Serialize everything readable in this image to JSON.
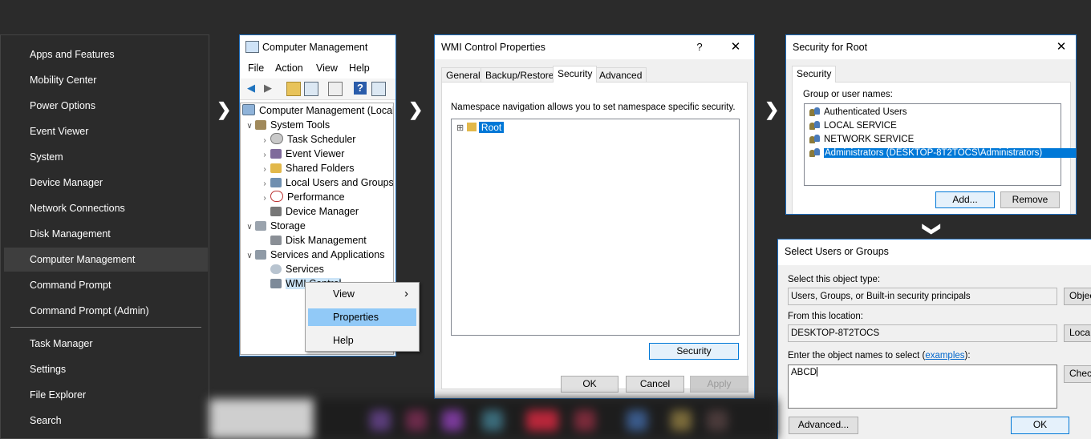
{
  "winx_menu": {
    "items": [
      "Apps and Features",
      "Mobility Center",
      "Power Options",
      "Event Viewer",
      "System",
      "Device Manager",
      "Network Connections",
      "Disk Management",
      "Computer Management",
      "Command Prompt",
      "Command Prompt (Admin)",
      "Task Manager",
      "Settings",
      "File Explorer",
      "Search"
    ],
    "selected": "Computer Management"
  },
  "arrows": {
    "right": "❯",
    "down": "❯"
  },
  "computer_management": {
    "title": "Computer Management",
    "menu": [
      "File",
      "Action",
      "View",
      "Help"
    ],
    "tree": [
      "Computer Management (Local",
      "System Tools",
      "Task Scheduler",
      "Event Viewer",
      "Shared Folders",
      "Local Users and Groups",
      "Performance",
      "Device Manager",
      "Storage",
      "Disk Management",
      "Services and Applications",
      "Services",
      "WMI Control"
    ],
    "context_menu": {
      "items": [
        "View",
        "Properties",
        "Help"
      ],
      "selected": "Properties",
      "submenu_arrow": "›"
    }
  },
  "wmi_dialog": {
    "title": "WMI Control Properties",
    "help_glyph": "?",
    "close_glyph": "✕",
    "tabs": [
      "General",
      "Backup/Restore",
      "Security",
      "Advanced"
    ],
    "active_tab": "Security",
    "description": "Namespace navigation allows you to set namespace specific security.",
    "tree_root": "Root",
    "expander": "⊞",
    "security_button": "Security",
    "ok": "OK",
    "cancel": "Cancel",
    "apply": "Apply"
  },
  "security_dialog": {
    "title": "Security for Root",
    "close_glyph": "✕",
    "tab": "Security",
    "group_label": "Group or user names:",
    "users": [
      "Authenticated Users",
      "LOCAL SERVICE",
      "NETWORK SERVICE",
      "Administrators (DESKTOP-8T2TOCS\\Administrators)"
    ],
    "selected_user": "Administrators (DESKTOP-8T2TOCS\\Administrators)",
    "add": "Add...",
    "remove": "Remove"
  },
  "select_dialog": {
    "title": "Select Users or Groups",
    "object_type_label": "Select this object type:",
    "object_type_value": "Users, Groups, or Built-in security principals",
    "object_types_button": "Objec",
    "location_label": "From this location:",
    "location_value": "DESKTOP-8T2TOCS",
    "locations_button": "Loca",
    "names_label_prefix": "Enter the object names to select (",
    "names_label_link": "examples",
    "names_label_suffix": "):",
    "names_value": "ABCD",
    "check_button": "Chec",
    "advanced": "Advanced...",
    "ok": "OK"
  }
}
